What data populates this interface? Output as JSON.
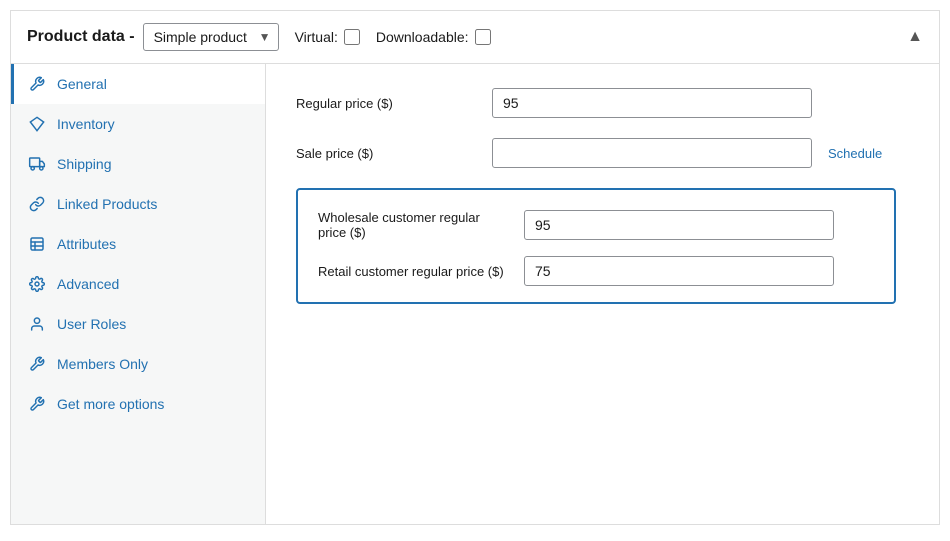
{
  "header": {
    "title": "Product data -",
    "product_type": "Simple product",
    "virtual_label": "Virtual:",
    "downloadable_label": "Downloadable:",
    "virtual_checked": false,
    "downloadable_checked": false
  },
  "sidebar": {
    "items": [
      {
        "id": "general",
        "label": "General",
        "icon": "wrench",
        "active": true
      },
      {
        "id": "inventory",
        "label": "Inventory",
        "icon": "diamond"
      },
      {
        "id": "shipping",
        "label": "Shipping",
        "icon": "truck"
      },
      {
        "id": "linked-products",
        "label": "Linked Products",
        "icon": "link"
      },
      {
        "id": "attributes",
        "label": "Attributes",
        "icon": "table"
      },
      {
        "id": "advanced",
        "label": "Advanced",
        "icon": "gear"
      },
      {
        "id": "user-roles",
        "label": "User Roles",
        "icon": "user"
      },
      {
        "id": "members-only",
        "label": "Members Only",
        "icon": "wrench2"
      },
      {
        "id": "get-more-options",
        "label": "Get more options",
        "icon": "wrench3"
      }
    ]
  },
  "main": {
    "regular_price_label": "Regular price ($)",
    "regular_price_value": "95",
    "sale_price_label": "Sale price ($)",
    "sale_price_value": "",
    "schedule_link": "Schedule",
    "wholesale_box": {
      "wholesale_label": "Wholesale customer regular price ($)",
      "wholesale_value": "95",
      "retail_label": "Retail customer regular price ($)",
      "retail_value": "75"
    }
  }
}
